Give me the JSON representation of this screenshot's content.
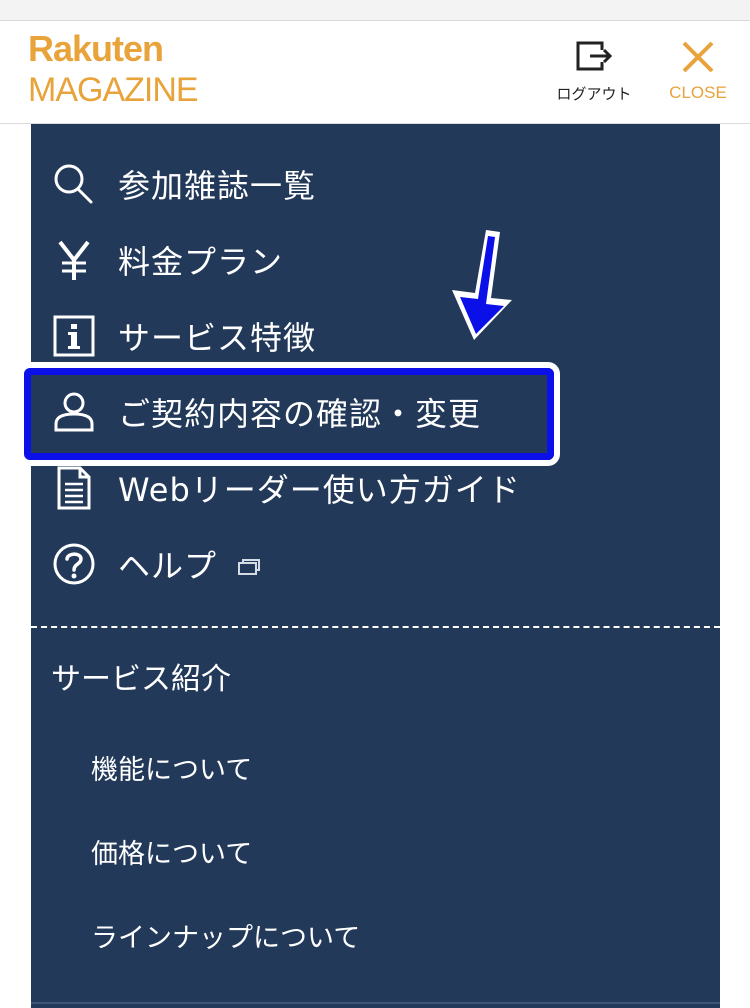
{
  "header": {
    "logo_line1": "Rakuten",
    "logo_line2": "MAGAZINE",
    "logout_label": "ログアウト",
    "close_label": "CLOSE",
    "accent_color": "#e8a33a"
  },
  "menu": {
    "background_color": "#22395a",
    "items": [
      {
        "label": "参加雑誌一覧",
        "icon": "search-icon"
      },
      {
        "label": "料金プラン",
        "icon": "yen-icon"
      },
      {
        "label": "サービス特徴",
        "icon": "info-icon"
      },
      {
        "label": "ご契約内容の確認・変更",
        "icon": "user-icon"
      },
      {
        "label": "Webリーダー使い方ガイド",
        "icon": "document-icon"
      },
      {
        "label": "ヘルプ",
        "icon": "help-icon",
        "external": true
      }
    ],
    "section_title": "サービス紹介",
    "sub_items": [
      {
        "label": "機能について"
      },
      {
        "label": "価格について"
      },
      {
        "label": "ラインナップについて"
      }
    ]
  },
  "annotation": {
    "highlight_color": "#0b10e8",
    "arrow_icon": "arrow-down-icon"
  }
}
